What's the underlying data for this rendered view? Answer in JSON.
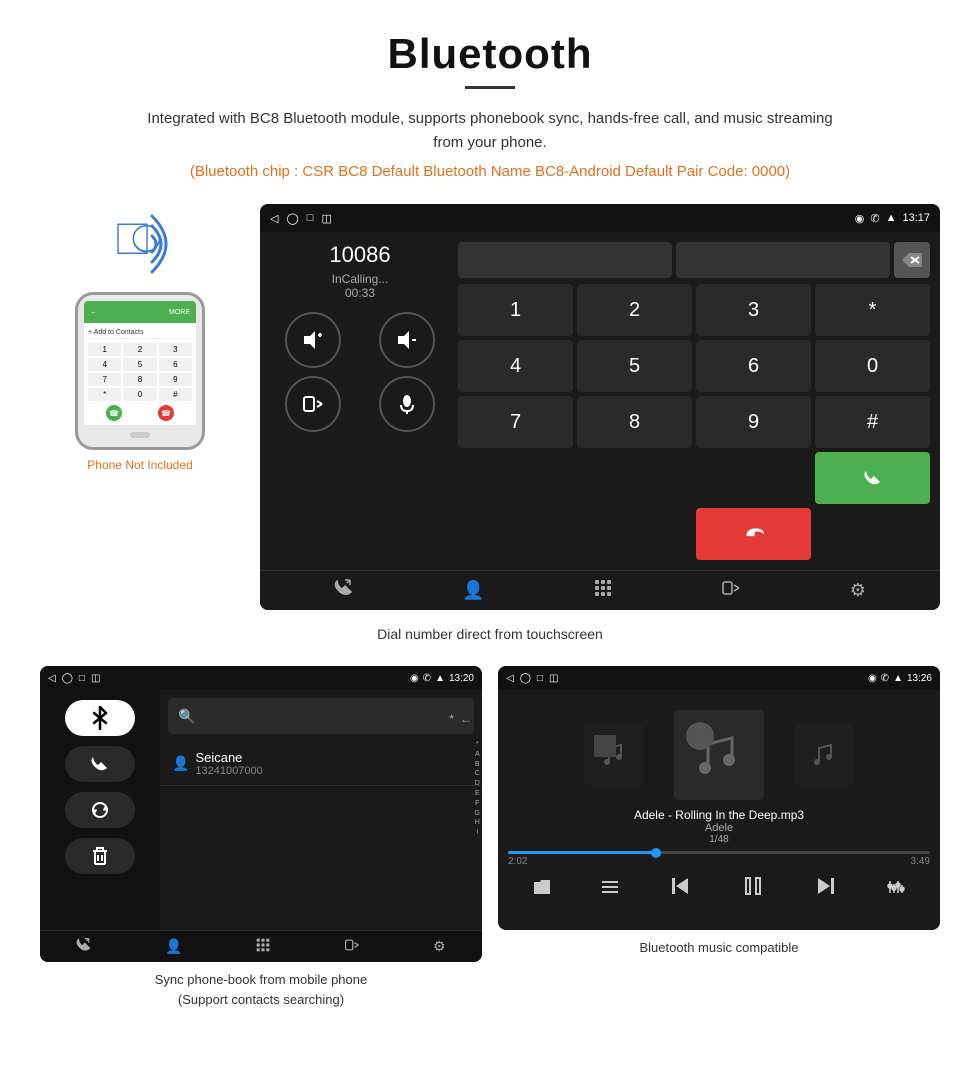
{
  "page": {
    "title": "Bluetooth",
    "subtitle": "Integrated with BC8 Bluetooth module, supports phonebook sync, hands-free call, and music streaming from your phone.",
    "orange_note": "(Bluetooth chip : CSR BC8    Default Bluetooth Name BC8-Android    Default Pair Code: 0000)",
    "dial_caption": "Dial number direct from touchscreen",
    "phonebook_caption_line1": "Sync phone-book from mobile phone",
    "phonebook_caption_line2": "(Support contacts searching)",
    "music_caption": "Bluetooth music compatible"
  },
  "dial_screen": {
    "status_time": "13:17",
    "call_number": "10086",
    "call_status": "InCalling...",
    "call_timer": "00:33",
    "keys": [
      "1",
      "2",
      "3",
      "*",
      "4",
      "5",
      "6",
      "0",
      "7",
      "8",
      "9",
      "#"
    ],
    "nav_icons": [
      "◁",
      "○",
      "□",
      "⊡"
    ]
  },
  "phonebook_screen": {
    "status_time": "13:20",
    "contact_name": "Seicane",
    "contact_number": "13241007000",
    "alpha_list": [
      "*",
      "A",
      "B",
      "C",
      "D",
      "E",
      "F",
      "G",
      "H",
      "I"
    ],
    "nav_icons": [
      "◁",
      "○",
      "□",
      "⊡"
    ]
  },
  "music_screen": {
    "status_time": "13:26",
    "song_title": "Adele - Rolling In the Deep.mp3",
    "artist": "Adele",
    "track_info": "1/48",
    "time_current": "2:02",
    "time_total": "3:49",
    "progress_percent": 35
  },
  "phone_mockup": {
    "not_included_label": "Phone Not Included"
  }
}
